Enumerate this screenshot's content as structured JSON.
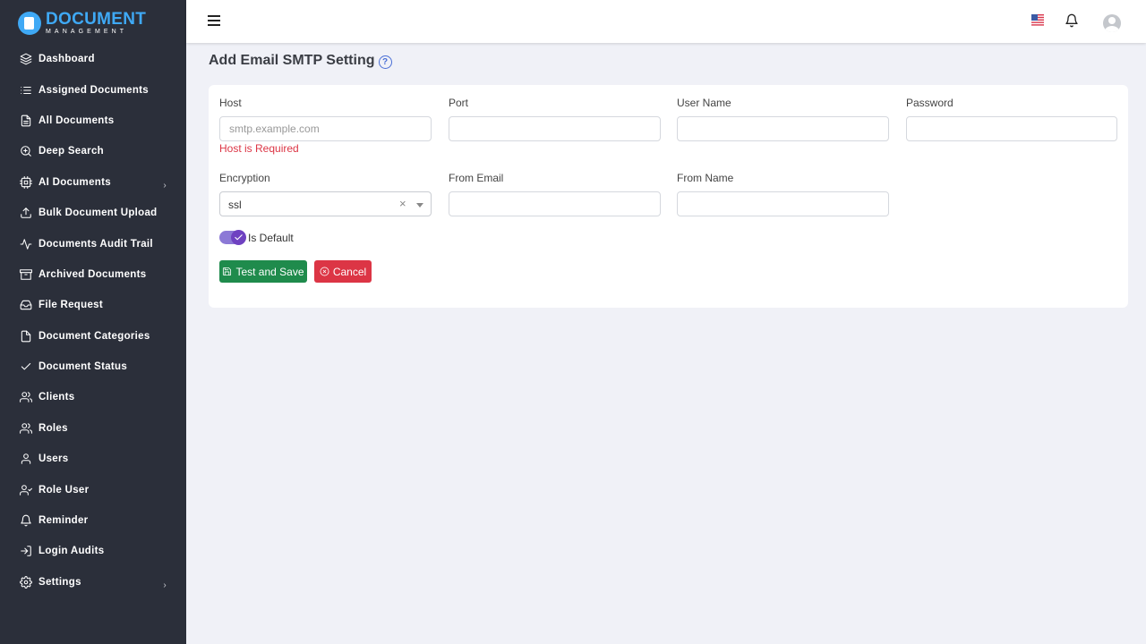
{
  "brand": {
    "name": "DOCUMENT",
    "subtitle": "MANAGEMENT"
  },
  "sidebar": {
    "items": [
      {
        "label": "Dashboard",
        "icon": "layers-icon"
      },
      {
        "label": "Assigned Documents",
        "icon": "list-icon"
      },
      {
        "label": "All Documents",
        "icon": "file-text-icon"
      },
      {
        "label": "Deep Search",
        "icon": "zoom-icon"
      },
      {
        "label": "AI Documents",
        "icon": "cpu-icon",
        "has_submenu": true
      },
      {
        "label": "Bulk Document Upload",
        "icon": "upload-icon"
      },
      {
        "label": "Documents Audit Trail",
        "icon": "activity-icon"
      },
      {
        "label": "Archived Documents",
        "icon": "archive-icon"
      },
      {
        "label": "File Request",
        "icon": "inbox-icon"
      },
      {
        "label": "Document Categories",
        "icon": "file-icon"
      },
      {
        "label": "Document Status",
        "icon": "check-icon"
      },
      {
        "label": "Clients",
        "icon": "users-icon"
      },
      {
        "label": "Roles",
        "icon": "users-icon"
      },
      {
        "label": "Users",
        "icon": "user-icon"
      },
      {
        "label": "Role User",
        "icon": "user-check-icon"
      },
      {
        "label": "Reminder",
        "icon": "bell-icon"
      },
      {
        "label": "Login Audits",
        "icon": "log-in-icon"
      },
      {
        "label": "Settings",
        "icon": "settings-icon",
        "has_submenu": true
      }
    ]
  },
  "header": {
    "language_flag": "us-flag-icon"
  },
  "page": {
    "title": "Add Email SMTP Setting",
    "help": "?"
  },
  "form": {
    "host": {
      "label": "Host",
      "value": "",
      "placeholder": "smtp.example.com",
      "error": "Host is Required"
    },
    "port": {
      "label": "Port",
      "value": ""
    },
    "username": {
      "label": "User Name",
      "value": ""
    },
    "password": {
      "label": "Password",
      "value": ""
    },
    "encryption": {
      "label": "Encryption",
      "value": "ssl",
      "clear": "×"
    },
    "from_email": {
      "label": "From Email",
      "value": ""
    },
    "from_name": {
      "label": "From Name",
      "value": ""
    },
    "is_default": {
      "label": "Is Default",
      "checked": true
    },
    "save_label": "Test and Save",
    "cancel_label": "Cancel"
  },
  "colors": {
    "sidebar_bg": "#2b2f3a",
    "brand_blue": "#3fa9f5",
    "save_green": "#1f8b4c",
    "cancel_red": "#dc3545",
    "toggle_purple": "#6f42c1",
    "error_red": "#dc3545"
  }
}
